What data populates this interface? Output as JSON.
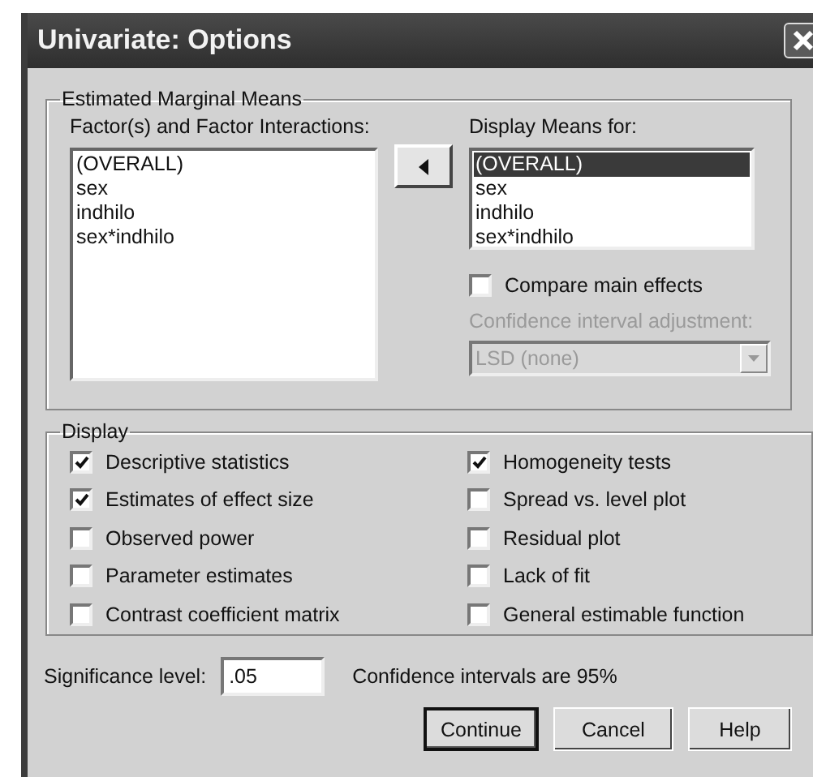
{
  "window": {
    "title": "Univariate: Options"
  },
  "emm": {
    "title": "Estimated Marginal Means",
    "factors_label": "Factor(s) and Factor Interactions:",
    "factors": [
      {
        "label": "(OVERALL)",
        "selected": false
      },
      {
        "label": "sex",
        "selected": false
      },
      {
        "label": "indhilo",
        "selected": false
      },
      {
        "label": "sex*indhilo",
        "selected": false
      }
    ],
    "display_label": "Display Means for:",
    "display_means": [
      {
        "label": "(OVERALL)",
        "selected": true
      },
      {
        "label": "sex",
        "selected": false
      },
      {
        "label": "indhilo",
        "selected": false
      },
      {
        "label": "sex*indhilo",
        "selected": false
      }
    ],
    "compare_main_effects": {
      "label": "Compare main effects",
      "checked": false
    },
    "ci_adjustment": {
      "label": "Confidence interval adjustment:",
      "value": "LSD (none)",
      "disabled": true
    }
  },
  "display": {
    "title": "Display",
    "options": [
      {
        "label": "Descriptive statistics",
        "checked": true
      },
      {
        "label": "Homogeneity tests",
        "checked": true
      },
      {
        "label": "Estimates of effect size",
        "checked": true
      },
      {
        "label": "Spread vs. level plot",
        "checked": false
      },
      {
        "label": "Observed power",
        "checked": false
      },
      {
        "label": "Residual plot",
        "checked": false
      },
      {
        "label": "Parameter estimates",
        "checked": false
      },
      {
        "label": "Lack of fit",
        "checked": false
      },
      {
        "label": "Contrast coefficient matrix",
        "checked": false
      },
      {
        "label": "General estimable function",
        "checked": false
      }
    ]
  },
  "significance": {
    "label": "Significance level:",
    "value": ".05"
  },
  "confidence_note": "Confidence intervals are 95%",
  "buttons": [
    {
      "label": "Continue",
      "default": true
    },
    {
      "label": "Cancel",
      "default": false
    },
    {
      "label": "Help",
      "default": false
    }
  ]
}
